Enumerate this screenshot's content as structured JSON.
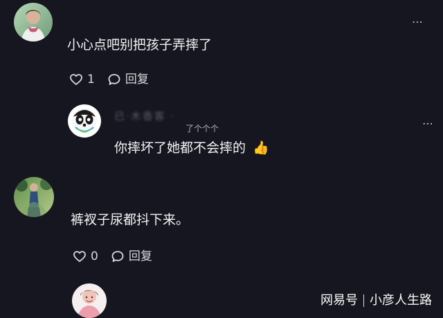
{
  "comments": [
    {
      "text": "小心点吧别把孩子弄摔了",
      "like_count": "1",
      "reply_label": "回复"
    },
    {
      "text": "裤衩子尿都抖下来。",
      "like_count": "0",
      "reply_label": "回复"
    }
  ],
  "reply": {
    "name_blurred": "已·木香客 ·",
    "overlay_text": "了个个个",
    "text": "你摔坏了她都不会摔的",
    "emoji": "👍"
  },
  "watermark": {
    "brand": "网易号",
    "author": "小彦人生路"
  },
  "icons": {
    "more": "more-dots-icon",
    "like": "heart-icon",
    "reply": "chat-bubble-icon"
  }
}
